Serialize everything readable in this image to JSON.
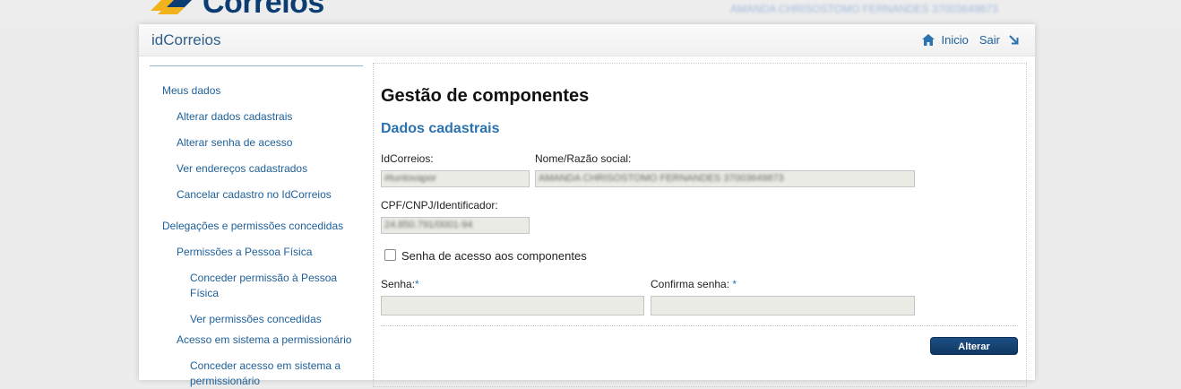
{
  "brand": {
    "logo_text": "Correios",
    "user_name": "AMANDA CHRISOSTOMO FERNANDES 37003649873"
  },
  "header": {
    "app_title": "idCorreios",
    "nav": {
      "home_label": "Inicio",
      "exit_label": "Sair"
    }
  },
  "sidebar": {
    "items": [
      {
        "label": "Meus dados",
        "level": 0
      },
      {
        "label": "Alterar dados cadastrais",
        "level": 1
      },
      {
        "label": "Alterar senha de acesso",
        "level": 1
      },
      {
        "label": "Ver endereços cadastrados",
        "level": 1
      },
      {
        "label": "Cancelar cadastro no IdCorreios",
        "level": 1
      },
      {
        "label": "Delegações e permissões concedidas",
        "level": 0
      },
      {
        "label": "Permissões a Pessoa Física",
        "level": 1
      },
      {
        "label": "Conceder permissão à Pessoa Física",
        "level": 2
      },
      {
        "label": "Ver permissões concedidas",
        "level": 2
      },
      {
        "label": "Acesso em sistema a permissionário",
        "level": 1
      },
      {
        "label": "Conceder acesso em sistema a permissionário",
        "level": 2
      }
    ]
  },
  "main": {
    "title": "Gestão de componentes",
    "section": "Dados cadastrais",
    "fields": {
      "idcorreios": {
        "label": "IdCorreios:",
        "value": "#tuntovapor"
      },
      "nome": {
        "label": "Nome/Razão social:",
        "value": "AMANDA CHRISOSTOMO FERNANDES 37003649873"
      },
      "cpf": {
        "label": "CPF/CNPJ/Identificador:",
        "value": "24.850.791/0001-94"
      },
      "senha": {
        "label": "Senha:",
        "required": "*",
        "value": ""
      },
      "confirma": {
        "label": "Confirma senha:",
        "required": "*",
        "value": ""
      }
    },
    "checkbox": {
      "label": "Senha de acesso aos componentes",
      "checked": false
    },
    "submit_label": "Alterar"
  },
  "colors": {
    "link": "#1f6099",
    "accent": "#2a72b0",
    "button": "#163f6e",
    "logo_blue": "#0b3d73",
    "logo_yellow": "#f2b21c"
  }
}
